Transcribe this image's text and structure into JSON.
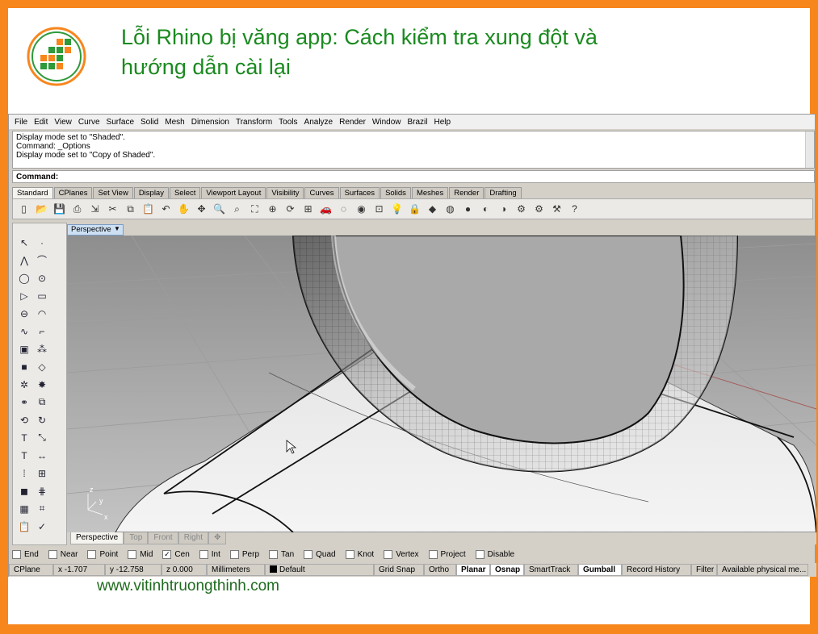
{
  "article": {
    "title": "Lỗi Rhino bị văng app: Cách kiểm tra xung đột và hướng dẫn cài lại",
    "website": "www.vitinhtruongthinh.com"
  },
  "colors": {
    "frame": "#f7861d",
    "title": "#1a8a1f",
    "logo_green": "#2e9a3a",
    "logo_orange": "#f7861d"
  },
  "menu": [
    "File",
    "Edit",
    "View",
    "Curve",
    "Surface",
    "Solid",
    "Mesh",
    "Dimension",
    "Transform",
    "Tools",
    "Analyze",
    "Render",
    "Window",
    "Brazil",
    "Help"
  ],
  "command": {
    "history": [
      "Display mode set to \"Shaded\".",
      "Command: _Options",
      "Display mode set to \"Copy of Shaded\"."
    ],
    "prompt": "Command:"
  },
  "toolbar_tabs": [
    "Standard",
    "CPlanes",
    "Set View",
    "Display",
    "Select",
    "Viewport Layout",
    "Visibility",
    "Curves",
    "Surfaces",
    "Solids",
    "Meshes",
    "Render",
    "Drafting"
  ],
  "toolbar_icons": [
    "new-icon",
    "open-icon",
    "save-icon",
    "print-icon",
    "import-icon",
    "cut-icon",
    "copy-icon",
    "paste-icon",
    "undo-icon",
    "pan-icon",
    "rotate-icon",
    "zoom-icon",
    "zoom-window-icon",
    "zoom-extents-icon",
    "zoom-selected-icon",
    "redraw-icon",
    "viewport-grid-icon",
    "car-icon",
    "hide-icon",
    "show-icon",
    "lock-icon",
    "light-icon",
    "lock2-icon",
    "color-icon",
    "material-icon",
    "sphere-icon",
    "sphere2-icon",
    "render-icon",
    "settings-icon",
    "gear-icon",
    "options-icon",
    "help-icon"
  ],
  "left_icons": [
    "select-arrow",
    "point",
    "polyline",
    "curve-points",
    "circle",
    "arc-circle",
    "polygon",
    "rectangle",
    "ellipse",
    "arc",
    "free-curve",
    "fillet",
    "box",
    "sphere-multi",
    "cube-blue",
    "surface",
    "gear-fold",
    "explode",
    "boolean",
    "extract",
    "move",
    "rotate",
    "mirror",
    "scale",
    "text",
    "dim",
    "array",
    "group",
    "solid-blue",
    "hatch",
    "layers",
    "blocks",
    "clipboard",
    "check"
  ],
  "viewport": {
    "active": "Perspective",
    "tabs": [
      "Perspective",
      "Top",
      "Front",
      "Right"
    ],
    "axis": [
      "z",
      "y",
      "x"
    ]
  },
  "osnap": [
    {
      "label": "End",
      "checked": false
    },
    {
      "label": "Near",
      "checked": false
    },
    {
      "label": "Point",
      "checked": false
    },
    {
      "label": "Mid",
      "checked": false
    },
    {
      "label": "Cen",
      "checked": true
    },
    {
      "label": "Int",
      "checked": false
    },
    {
      "label": "Perp",
      "checked": false
    },
    {
      "label": "Tan",
      "checked": false
    },
    {
      "label": "Quad",
      "checked": false
    },
    {
      "label": "Knot",
      "checked": false
    },
    {
      "label": "Vertex",
      "checked": false
    },
    {
      "label": "Project",
      "checked": false
    },
    {
      "label": "Disable",
      "checked": false
    }
  ],
  "status": {
    "cplane": "CPlane",
    "x": "x -1.707",
    "y": "y -12.758",
    "z": "z 0.000",
    "units": "Millimeters",
    "layer": "Default",
    "grid_snap": "Grid Snap",
    "ortho": "Ortho",
    "planar": "Planar",
    "osnap": "Osnap",
    "smarttrack": "SmartTrack",
    "gumball": "Gumball",
    "record": "Record History",
    "filter": "Filter",
    "memory": "Available physical me..."
  }
}
